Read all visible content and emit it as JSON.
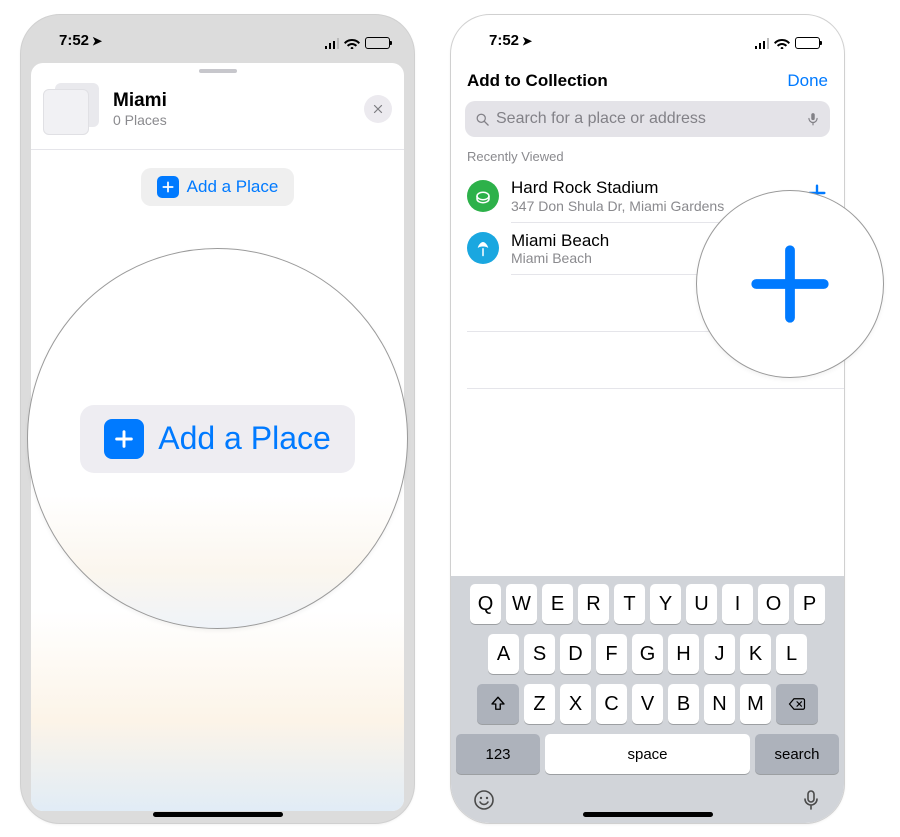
{
  "status": {
    "time": "7:52",
    "location_glyph": "➤"
  },
  "left": {
    "collection": {
      "title": "Miami",
      "subtitle": "0 Places"
    },
    "add_button_label": "Add a Place"
  },
  "right": {
    "header": {
      "title": "Add to Collection",
      "done": "Done"
    },
    "search": {
      "placeholder": "Search for a place or address"
    },
    "section_label": "Recently Viewed",
    "places": [
      {
        "title": "Hard Rock Stadium",
        "subtitle": "347 Don Shula Dr, Miami Gardens"
      },
      {
        "title": "Miami Beach",
        "subtitle": "Miami Beach"
      }
    ]
  },
  "keyboard": {
    "row1": [
      "Q",
      "W",
      "E",
      "R",
      "T",
      "Y",
      "U",
      "I",
      "O",
      "P"
    ],
    "row2": [
      "A",
      "S",
      "D",
      "F",
      "G",
      "H",
      "J",
      "K",
      "L"
    ],
    "row3": [
      "Z",
      "X",
      "C",
      "V",
      "B",
      "N",
      "M"
    ],
    "numbers_label": "123",
    "space_label": "space",
    "return_label": "search"
  }
}
